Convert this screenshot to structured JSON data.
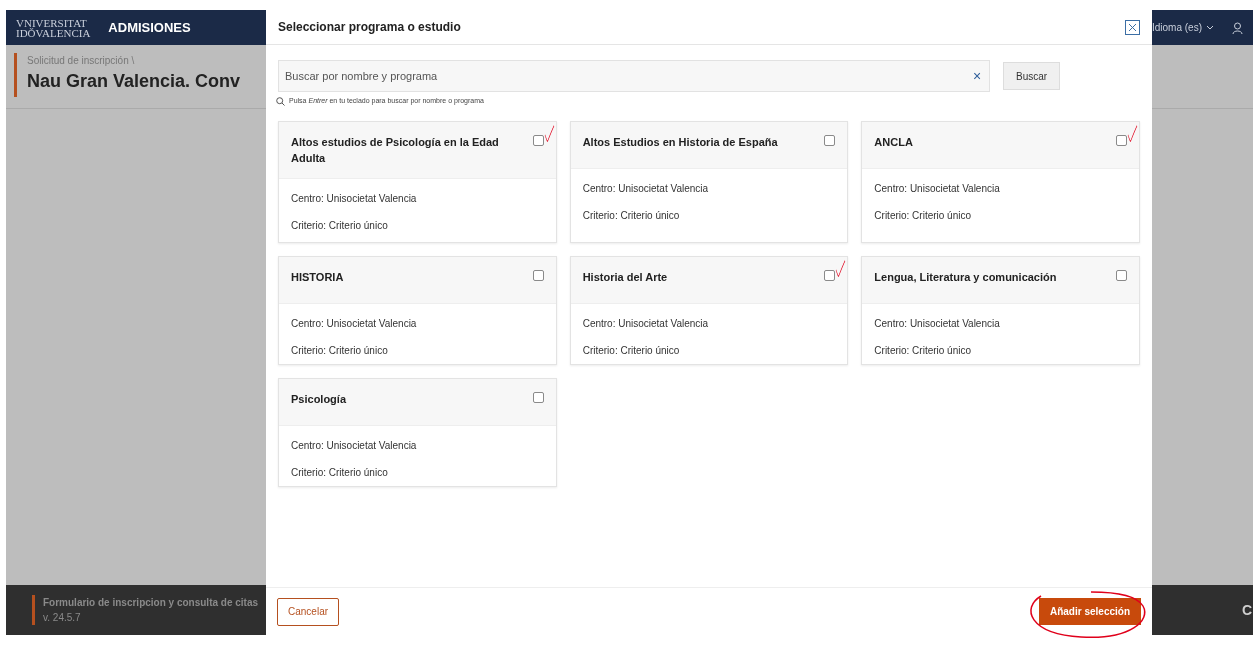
{
  "app_header": {
    "logo_line_1": "VNIVERSITAT",
    "logo_line_2": "IDǑVALENCIA",
    "title": "ADMISIONES",
    "language": "Idioma (es)"
  },
  "page": {
    "breadcrumb": "Solicitud de inscripción \\",
    "title": "Nau Gran Valencia. Conv"
  },
  "app_footer": {
    "title": "Formulario de inscripcion y consulta de citas",
    "version": "v. 24.5.7",
    "right_text": "C"
  },
  "modal": {
    "title": "Seleccionar programa o estudio",
    "search": {
      "placeholder": "Buscar por nombre y programa",
      "clear": "×",
      "button": "Buscar",
      "hint": "Pulsa *Entrer* en tu teclado para buscar por nombre o programa"
    },
    "programs": [
      {
        "name": "Altos estudios de Psicología en la Edad Adulta",
        "centro": "Centro: Unisocietat Valencia",
        "criterio": "Criterio: Criterio único",
        "checked": false,
        "hand_check": true
      },
      {
        "name": "Altos Estudios en Historia de España",
        "centro": "Centro: Unisocietat Valencia",
        "criterio": "Criterio: Criterio único",
        "checked": false,
        "hand_check": false
      },
      {
        "name": "ANCLA",
        "centro": "Centro: Unisocietat Valencia",
        "criterio": "Criterio: Criterio único",
        "checked": false,
        "hand_check": true
      },
      {
        "name": "HISTORIA",
        "centro": "Centro: Unisocietat Valencia",
        "criterio": "Criterio: Criterio único",
        "checked": false,
        "hand_check": false
      },
      {
        "name": "Historia del Arte",
        "centro": "Centro: Unisocietat Valencia",
        "criterio": "Criterio: Criterio único",
        "checked": false,
        "hand_check": true
      },
      {
        "name": "Lengua, Literatura y comunicación",
        "centro": "Centro: Unisocietat Valencia",
        "criterio": "Criterio: Criterio único",
        "checked": false,
        "hand_check": false
      },
      {
        "name": "Psicología",
        "centro": "Centro: Unisocietat Valencia",
        "criterio": "Criterio: Criterio único",
        "checked": false,
        "hand_check": false
      }
    ],
    "cancel": "Cancelar",
    "confirm": {
      "label": "Añadir selección",
      "hand_circle": true
    }
  }
}
